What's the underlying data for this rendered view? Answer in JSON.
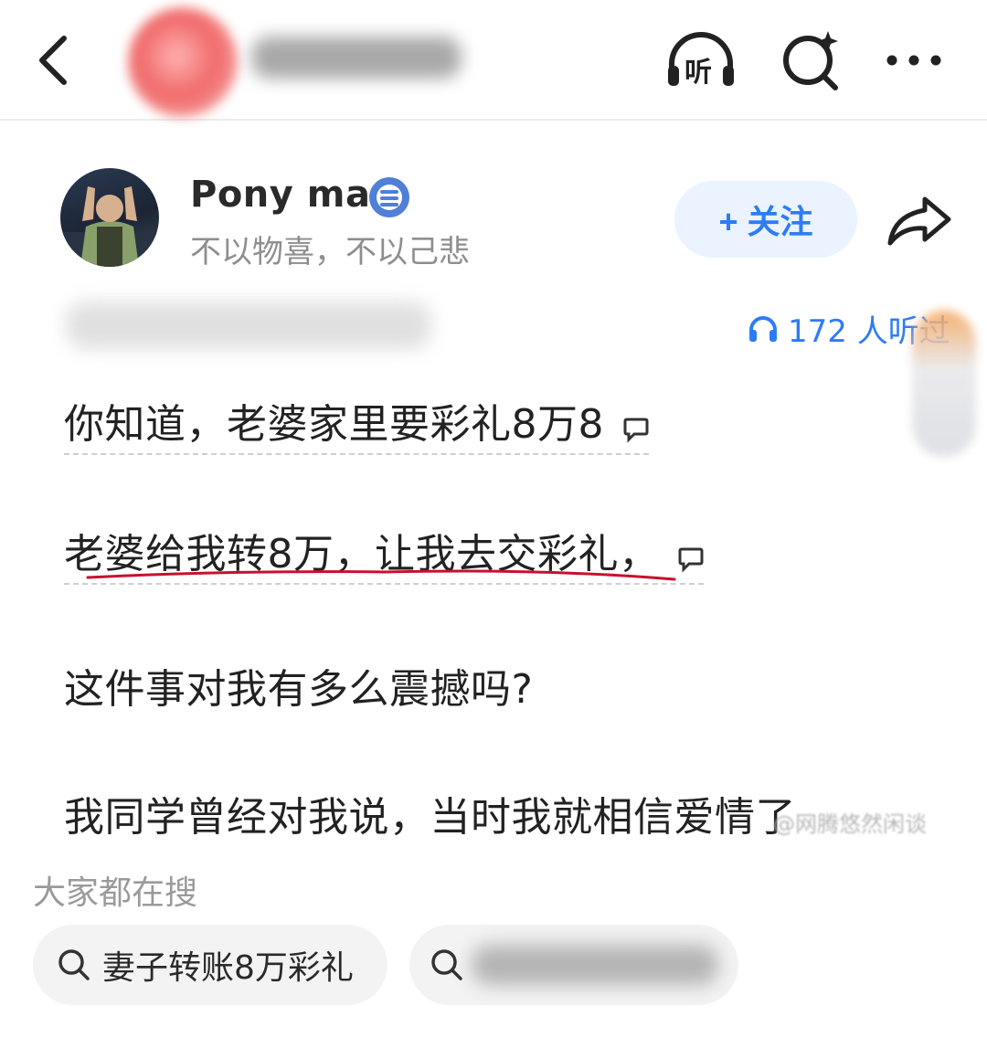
{
  "header": {
    "back_icon": "chevron-left-icon",
    "listen_label": "听",
    "actions": [
      "headphones-listen-icon",
      "ai-search-icon",
      "more-dots-icon"
    ]
  },
  "author": {
    "name": "Pony ma",
    "bio": "不以物喜，不以己悲",
    "follow_label": "+ 关注",
    "badge_icon": "verified-badge-icon",
    "share_icon": "share-arrow-icon"
  },
  "meta": {
    "listen_count": "172 人听过"
  },
  "content": {
    "paragraphs": [
      "你知道，老婆家里要彩礼8万8",
      "老婆给我转8万，让我去交彩礼，",
      "这件事对我有多么震撼吗?",
      "我同学曾经对我说，当时我就相信爱情了"
    ],
    "watermark": "@网腾悠然闲谈"
  },
  "search": {
    "title": "大家都在搜",
    "chips": [
      "妻子转账8万彩礼"
    ]
  },
  "colors": {
    "accent": "#2d7cf6",
    "follow_bg": "#eaf3ff",
    "underline_red": "#c8102e"
  }
}
